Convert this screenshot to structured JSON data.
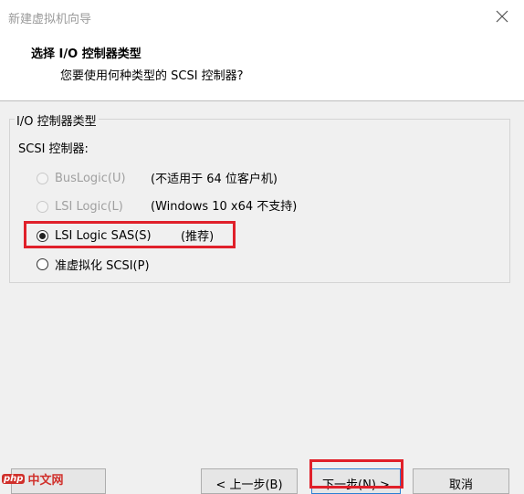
{
  "window": {
    "title": "新建虚拟机向导"
  },
  "header": {
    "title": "选择 I/O 控制器类型",
    "subtitle": "您要使用何种类型的 SCSI 控制器?"
  },
  "group": {
    "legend": "I/O 控制器类型",
    "sublabel": "SCSI 控制器:",
    "options": [
      {
        "label": "BusLogic(U)",
        "note": "(不适用于 64 位客户机)",
        "enabled": false,
        "checked": false
      },
      {
        "label": "LSI Logic(L)",
        "note": "(Windows 10 x64 不支持)",
        "enabled": false,
        "checked": false
      },
      {
        "label": "LSI Logic SAS(S)",
        "note": "(推荐)",
        "enabled": true,
        "checked": true
      },
      {
        "label": "准虚拟化 SCSI(P)",
        "note": "",
        "enabled": true,
        "checked": false
      }
    ]
  },
  "buttons": {
    "help": "",
    "back": "< 上一步(B)",
    "next": "下一步(N) >",
    "cancel": "取消"
  },
  "watermark": {
    "badge": "php",
    "text": "中文网"
  },
  "colors": {
    "highlight": "#e0202a",
    "focus": "#2a7fd4"
  }
}
